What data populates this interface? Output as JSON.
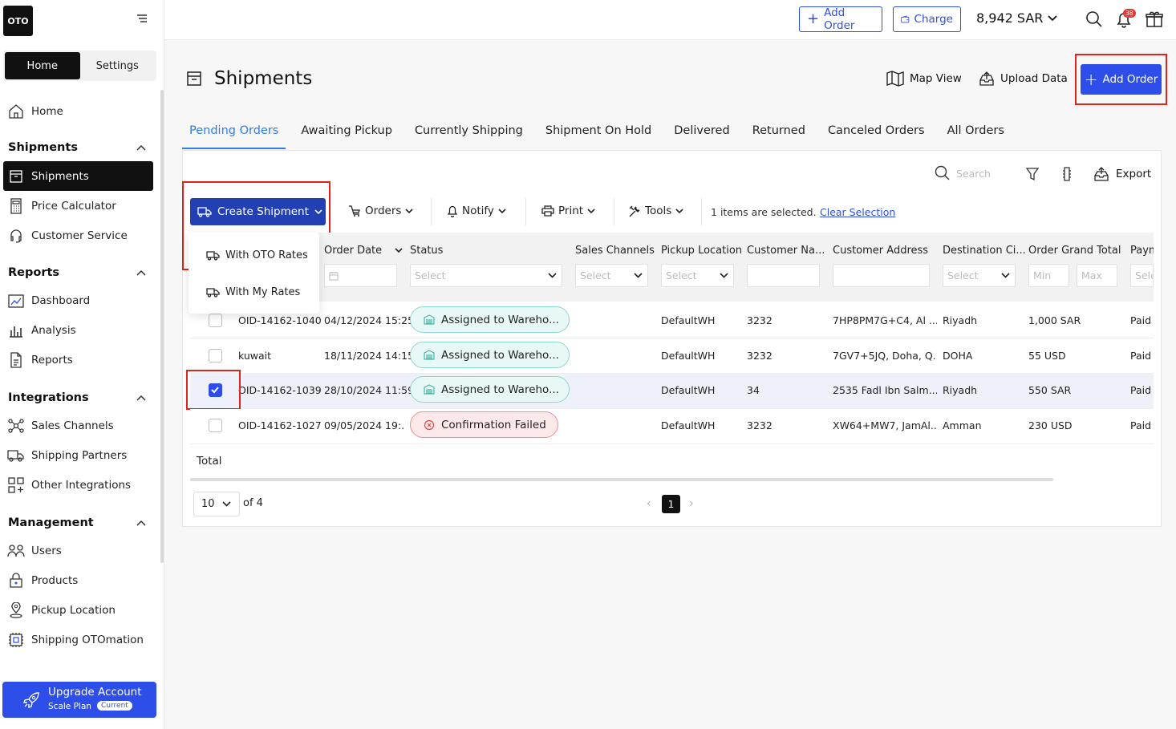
{
  "logo": "OTO",
  "sidebar": {
    "seg_home": "Home",
    "seg_settings": "Settings",
    "home": "Home",
    "sections": {
      "shipments": "Shipments",
      "reports": "Reports",
      "integrations": "Integrations",
      "management": "Management"
    },
    "items": {
      "shipments": "Shipments",
      "price_calculator": "Price Calculator",
      "customer_service": "Customer Service",
      "dashboard": "Dashboard",
      "analysis": "Analysis",
      "reports": "Reports",
      "sales_channels": "Sales Channels",
      "shipping_partners": "Shipping Partners",
      "other_integrations": "Other Integrations",
      "users": "Users",
      "products": "Products",
      "pickup_location": "Pickup Location",
      "shipping_otomation": "Shipping OTOmation"
    },
    "upgrade": {
      "title": "Upgrade Account",
      "plan": "Scale Plan",
      "badge": "Current"
    }
  },
  "topbar": {
    "add_order": "Add Order",
    "charge": "Charge",
    "balance": "8,942 SAR",
    "notif_count": "38"
  },
  "page": {
    "title": "Shipments",
    "map_view": "Map View",
    "upload_data": "Upload Data",
    "add_order": "Add Order"
  },
  "tabs": [
    "Pending Orders",
    "Awaiting Pickup",
    "Currently Shipping",
    "Shipment On Hold",
    "Delivered",
    "Returned",
    "Canceled Orders",
    "All Orders"
  ],
  "toolbar": {
    "search_placeholder": "Search",
    "export": "Export",
    "create_shipment": "Create Shipment",
    "orders": "Orders",
    "notify": "Notify",
    "print": "Print",
    "tools": "Tools",
    "selected_count": "1",
    "selected_text": "items are selected.",
    "clear_selection": "Clear Selection"
  },
  "dropdown": {
    "oto_rates": "With OTO Rates",
    "my_rates": "With My Rates"
  },
  "columns": {
    "order_date": "Order Date",
    "status": "Status",
    "sales_channels": "Sales Channels",
    "pickup_location": "Pickup Location",
    "customer_name": "Customer Na...",
    "customer_address": "Customer Address",
    "destination_city": "Destination Ci...",
    "order_grand_total": "Order Grand Total",
    "payment": "Paym"
  },
  "filters": {
    "select": "Select",
    "min": "Min",
    "max": "Max",
    "sele": "Sele"
  },
  "rows": [
    {
      "id": "OID-14162-1040",
      "date": "04/12/2024 15:25",
      "status": "Assigned to Wareho...",
      "pickup": "DefaultWH",
      "customer": "3232",
      "address": "7HP8PM7G+C4, Al ...",
      "city": "Riyadh",
      "total": "1,000 SAR",
      "payment": "Paid",
      "checked": false
    },
    {
      "id": "kuwait",
      "date": "18/11/2024 14:15",
      "status": "Assigned to Wareho...",
      "pickup": "DefaultWH",
      "customer": "3232",
      "address": "7GV7+5JQ, Doha, Q...",
      "city": "DOHA",
      "total": "55 USD",
      "payment": "Paid",
      "checked": false
    },
    {
      "id": "OID-14162-1039",
      "date": "28/10/2024 11:59",
      "status": "Assigned to Wareho...",
      "pickup": "DefaultWH",
      "customer": "34",
      "address": "2535 Fadl Ibn Salm...",
      "city": "Riyadh",
      "total": "550 SAR",
      "payment": "Paid",
      "checked": true
    },
    {
      "id": "OID-14162-1027",
      "date": "09/05/2024 19:...",
      "status": "Confirmation Failed",
      "pickup": "DefaultWH",
      "customer": "3232",
      "address": "XW64+MW7, JamAl...",
      "city": "Amman",
      "total": "230 USD",
      "payment": "Paid",
      "checked": false
    }
  ],
  "footer": {
    "total": "Total",
    "page_size": "10",
    "of": "of 4",
    "current_page": "1"
  },
  "colors": {
    "brand": "#2d4ee8",
    "dark": "#111111",
    "highlight": "#e0231c"
  }
}
